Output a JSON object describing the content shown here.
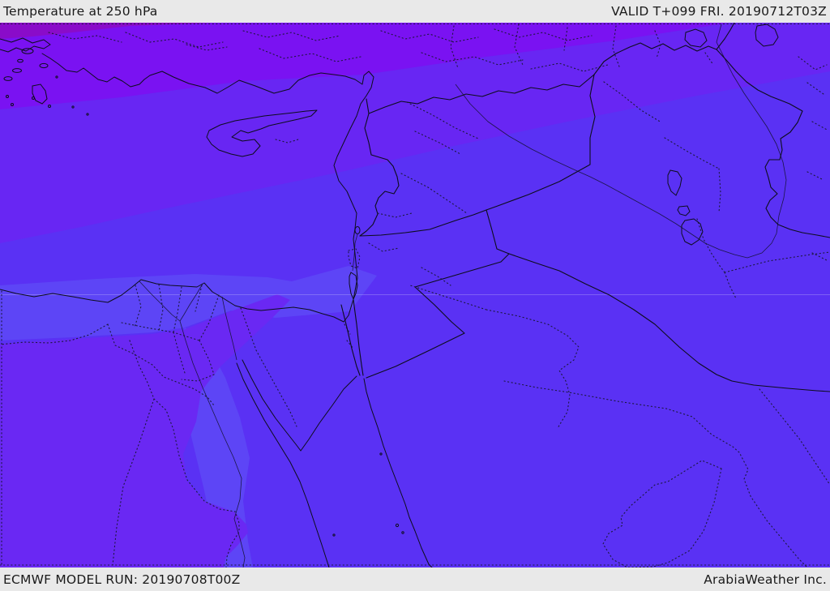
{
  "header": {
    "title": "Temperature at 250 hPa",
    "validity": "VALID T+099 FRI. 20190712T03Z"
  },
  "footer": {
    "model_run": "ECMWF MODEL RUN: 20190708T00Z",
    "provider": "ArabiaWeather Inc."
  },
  "map": {
    "description": "ECMWF 250 hPa temperature shading over the Middle East",
    "shading": {
      "base": "#5a31f4",
      "violet_blue": "#6826f3",
      "violet": "#7a12f2",
      "darkest": "#8a0cc9",
      "coastal_light": "#5d45f6",
      "egypt_wedge": "#6a28f3"
    },
    "bar_background": "#e9e9e9",
    "bar_text": "#1a1a1a"
  }
}
